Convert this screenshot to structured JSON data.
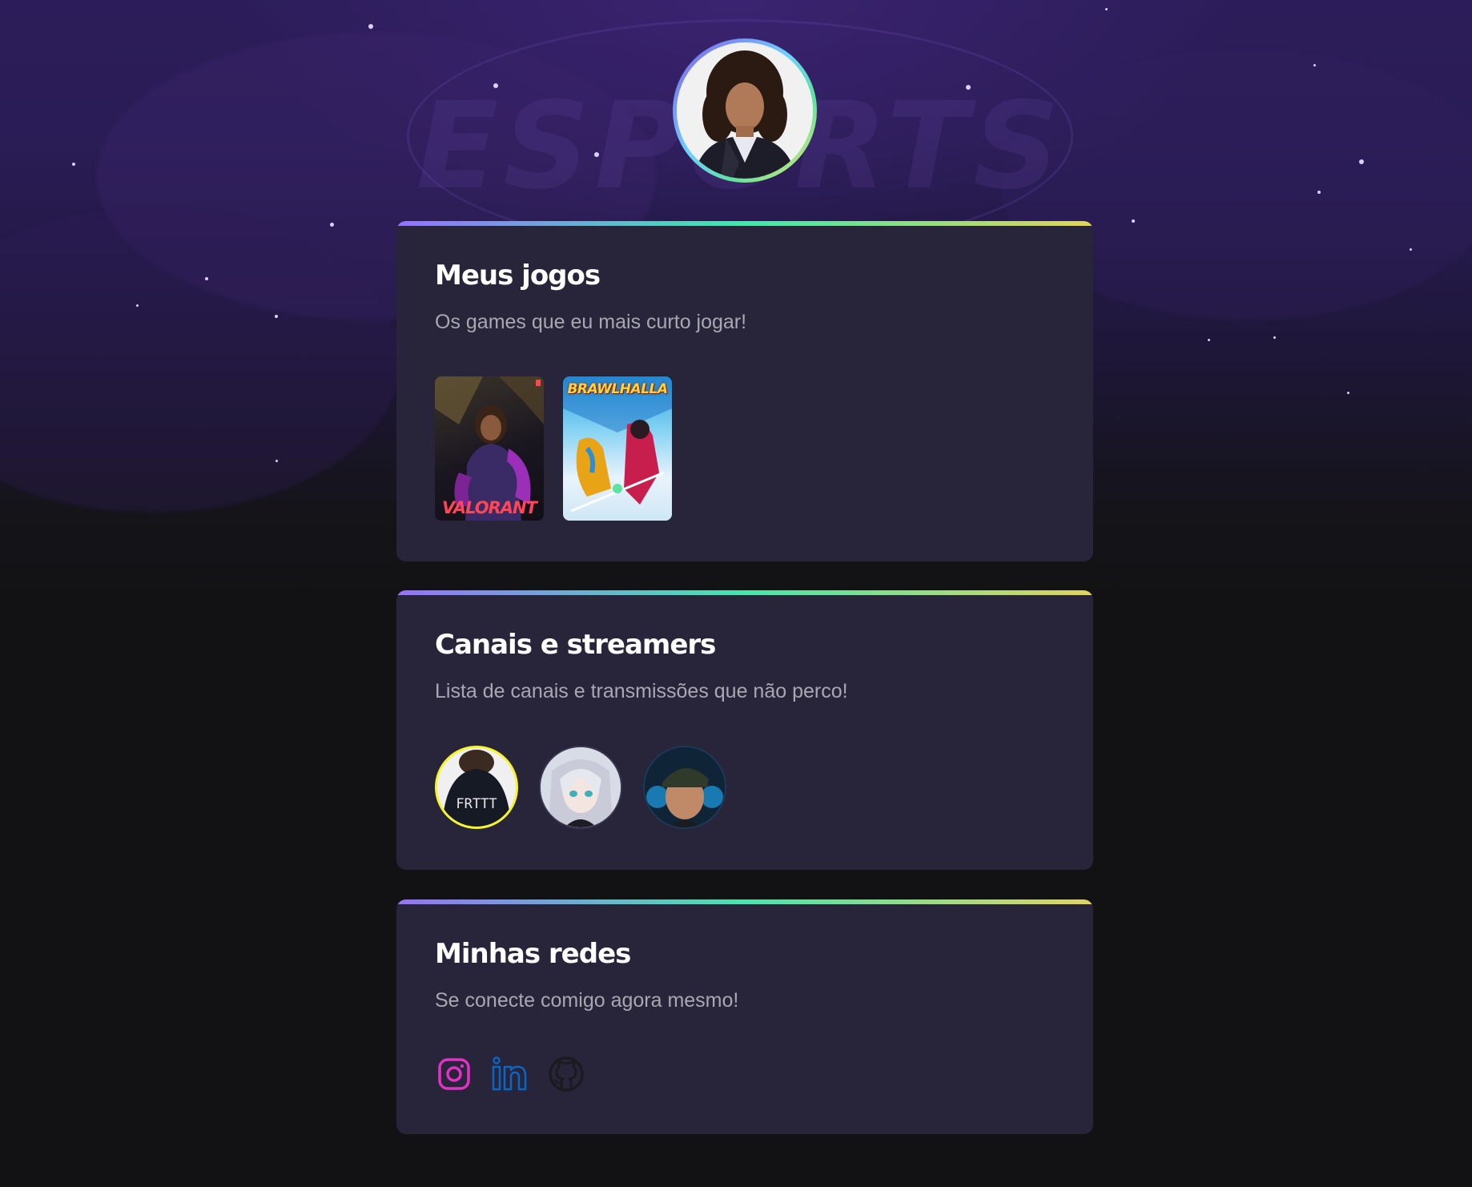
{
  "profile": {
    "avatar_alt": "profile photo"
  },
  "sections": {
    "games": {
      "title": "Meus jogos",
      "subtitle": "Os games que eu mais curto jogar!",
      "items": [
        {
          "name": "VALORANT"
        },
        {
          "name": "BRAWLHALLA"
        }
      ]
    },
    "streamers": {
      "title": "Canais e streamers",
      "subtitle": "Lista de canais e transmissões que não perco!",
      "items": [
        {
          "label": "FRTTT"
        },
        {
          "label": ""
        },
        {
          "label": ""
        }
      ]
    },
    "socials": {
      "title": "Minhas redes",
      "subtitle": "Se conecte comigo agora mesmo!",
      "items": [
        {
          "icon": "instagram-icon",
          "color": "#e530c8"
        },
        {
          "icon": "linkedin-icon",
          "color": "#0a66c2"
        },
        {
          "icon": "github-icon",
          "color": "#1b1b1f"
        }
      ]
    }
  },
  "background": {
    "watermark": "ESPORTS"
  },
  "colors": {
    "card_bg": "#28243a",
    "page_bg": "#121214",
    "gradient_start": "#9572fc",
    "gradient_mid": "#43e7ad",
    "gradient_end": "#e2d45c",
    "subtitle": "#a8a8b3"
  }
}
